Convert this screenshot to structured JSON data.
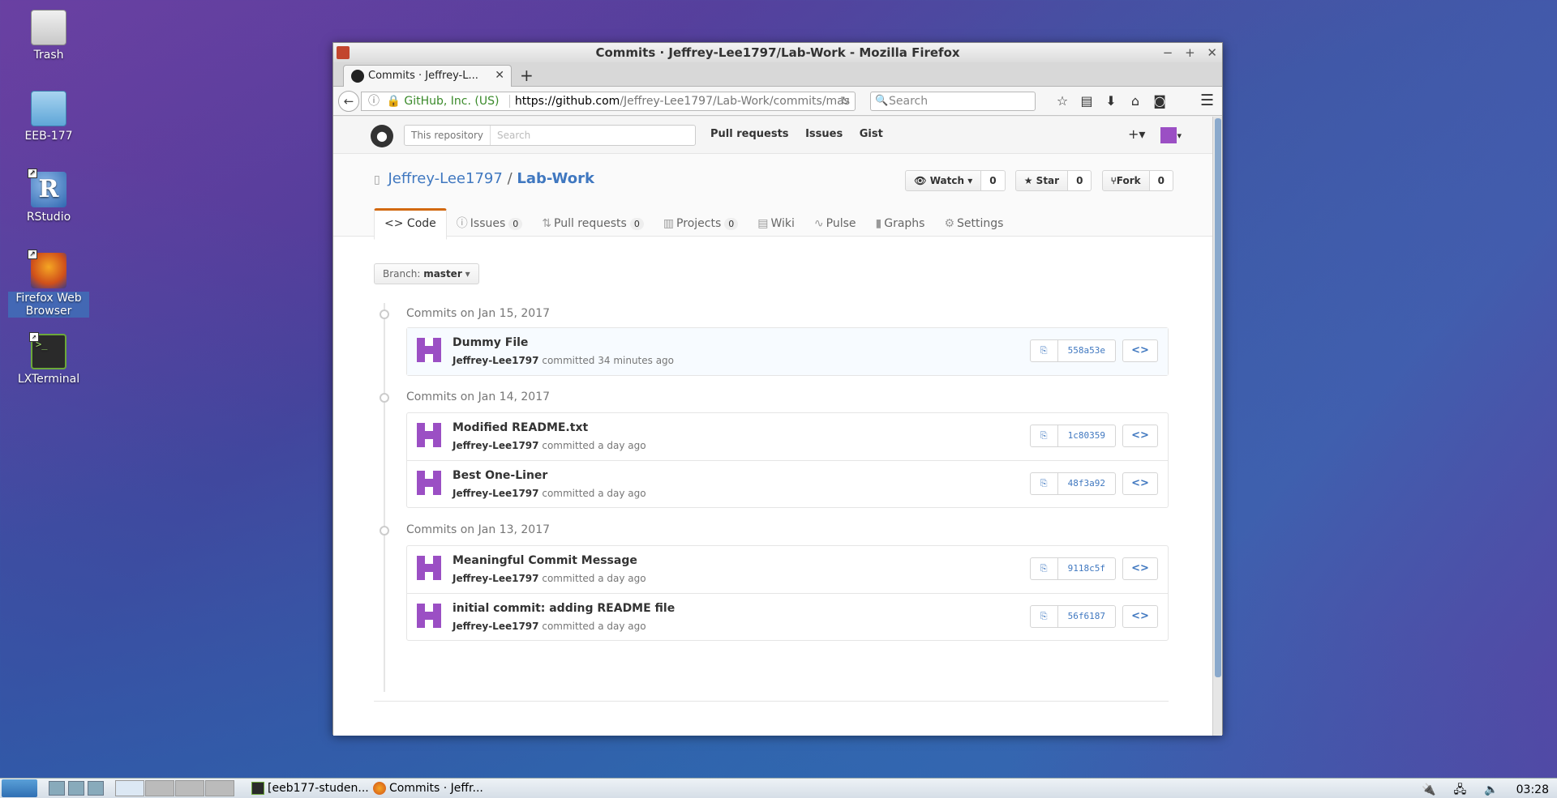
{
  "desktop": {
    "icons": [
      {
        "label": "Trash"
      },
      {
        "label": "EEB-177"
      },
      {
        "label": "RStudio"
      },
      {
        "label": "Firefox Web Browser"
      },
      {
        "label": "LXTerminal"
      }
    ]
  },
  "window": {
    "title": "Commits · Jeffrey-Lee1797/Lab-Work - Mozilla Firefox",
    "tab_label": "Commits · Jeffrey-L...",
    "url_org": "GitHub, Inc. (US)",
    "url_host": "https://github.com",
    "url_path": "/Jeffrey-Lee1797/Lab-Work/commits/mas",
    "search_placeholder": "Search"
  },
  "github": {
    "header": {
      "search_scope": "This repository",
      "search_placeholder": "Search",
      "nav": [
        "Pull requests",
        "Issues",
        "Gist"
      ]
    },
    "repo": {
      "owner": "Jeffrey-Lee1797",
      "separator": "/",
      "name": "Lab-Work",
      "watch_label": "Watch",
      "watch_count": "0",
      "star_label": "Star",
      "star_count": "0",
      "fork_label": "Fork",
      "fork_count": "0"
    },
    "reponav": {
      "code": "Code",
      "issues": "Issues",
      "issues_count": "0",
      "pulls": "Pull requests",
      "pulls_count": "0",
      "projects": "Projects",
      "projects_count": "0",
      "wiki": "Wiki",
      "pulse": "Pulse",
      "graphs": "Graphs",
      "settings": "Settings"
    },
    "branch": {
      "prefix": "Branch:",
      "name": "master"
    },
    "groups": [
      {
        "title": "Commits on Jan 15, 2017",
        "commits": [
          {
            "message": "Dummy File",
            "author": "Jeffrey-Lee1797",
            "verb": "committed",
            "time": "34 minutes ago",
            "sha": "558a53e"
          }
        ]
      },
      {
        "title": "Commits on Jan 14, 2017",
        "commits": [
          {
            "message": "Modified README.txt",
            "author": "Jeffrey-Lee1797",
            "verb": "committed",
            "time": "a day ago",
            "sha": "1c80359"
          },
          {
            "message": "Best One-Liner",
            "author": "Jeffrey-Lee1797",
            "verb": "committed",
            "time": "a day ago",
            "sha": "48f3a92"
          }
        ]
      },
      {
        "title": "Commits on Jan 13, 2017",
        "commits": [
          {
            "message": "Meaningful Commit Message",
            "author": "Jeffrey-Lee1797",
            "verb": "committed",
            "time": "a day ago",
            "sha": "9118c5f"
          },
          {
            "message": "initial commit: adding README file",
            "author": "Jeffrey-Lee1797",
            "verb": "committed",
            "time": "a day ago",
            "sha": "56f6187"
          }
        ]
      }
    ]
  },
  "taskbar": {
    "tasks": [
      "[eeb177-studen...",
      "Commits · Jeffr..."
    ],
    "clock": "03:28"
  }
}
